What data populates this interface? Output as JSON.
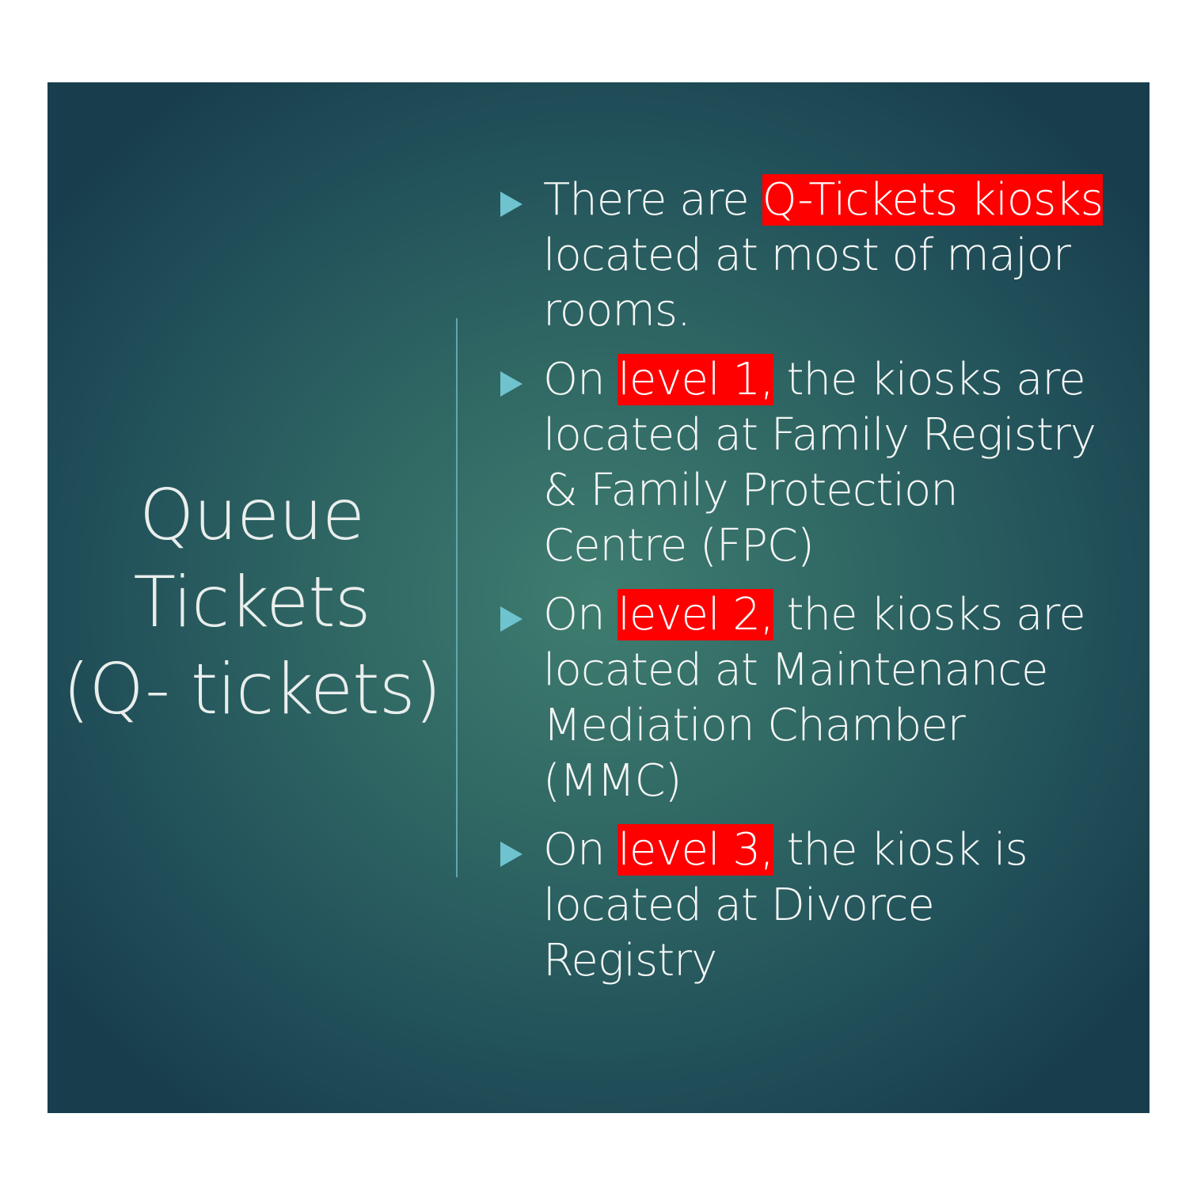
{
  "slide": {
    "title_lines": [
      "Queue",
      "Tickets",
      "(Q- tickets)"
    ],
    "bullets": [
      {
        "lines": [
          {
            "pre": "There are ",
            "hl": "Q-Tickets kiosks",
            "post": ""
          },
          {
            "pre": "located at most of major",
            "hl": "",
            "post": ""
          },
          {
            "pre": "rooms.",
            "hl": "",
            "post": ""
          }
        ]
      },
      {
        "lines": [
          {
            "pre": "On ",
            "hl": "level 1,",
            "post": " the kiosks are"
          },
          {
            "pre": "located at Family Registry",
            "hl": "",
            "post": ""
          },
          {
            "pre": "& Family Protection",
            "hl": "",
            "post": ""
          },
          {
            "pre": "Centre (FPC)",
            "hl": "",
            "post": ""
          }
        ]
      },
      {
        "lines": [
          {
            "pre": "On ",
            "hl": "level 2,",
            "post": " the kiosks are"
          },
          {
            "pre": "located at Maintenance",
            "hl": "",
            "post": ""
          },
          {
            "pre": "Mediation Chamber",
            "hl": "",
            "post": ""
          },
          {
            "pre": "(MMC)",
            "hl": "",
            "post": ""
          }
        ]
      },
      {
        "lines": [
          {
            "pre": "On ",
            "hl": "level 3,",
            "post": " the kiosk is"
          },
          {
            "pre": "located at Divorce",
            "hl": "",
            "post": ""
          },
          {
            "pre": "Registry",
            "hl": "",
            "post": ""
          }
        ]
      }
    ]
  },
  "colors": {
    "highlight": "#ff0000",
    "bullet_arrow": "#6fc3cf",
    "divider": "#5fa7b0",
    "text": "#f4f6f5"
  },
  "icons": {
    "bullet": "triangle-right-icon"
  }
}
